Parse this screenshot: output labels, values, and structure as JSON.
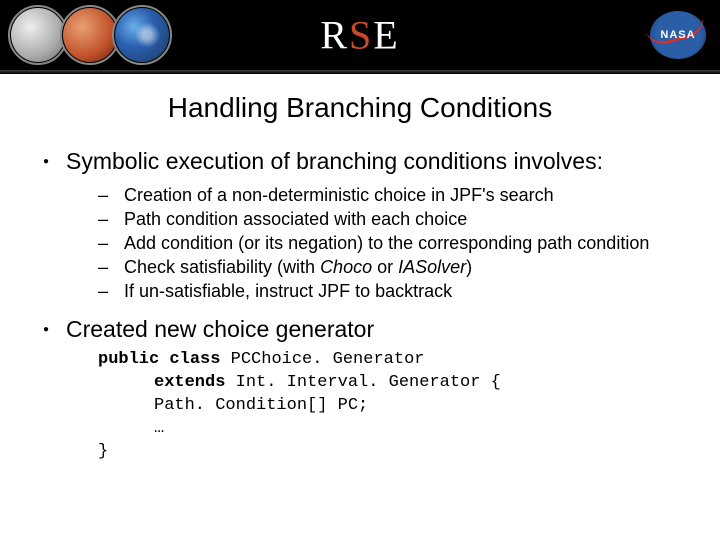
{
  "header": {
    "logo_R": "R",
    "logo_S": "S",
    "logo_E": "E",
    "nasa": "NASA"
  },
  "title": "Handling Branching Conditions",
  "bullets": {
    "b1": "Symbolic execution of branching conditions involves:",
    "sub": [
      "Creation of a non-deterministic choice in JPF's search",
      "Path condition associated with each choice",
      "Add condition (or its negation) to the corresponding path condition"
    ],
    "sub4_pre": "Check satisfiability (with ",
    "sub4_tool1": "Choco",
    "sub4_mid": " or ",
    "sub4_tool2": "IASolver",
    "sub4_post": ")",
    "sub5": "If un-satisfiable, instruct JPF to backtrack",
    "b2": "Created new choice generator"
  },
  "code": {
    "kw_public": "public",
    "kw_class": "class",
    "cls": " PCChoice. Generator",
    "kw_extends": "extends",
    "superc": " Int. Interval. Generator {",
    "field": "Path. Condition[] PC;",
    "dots": "…",
    "close": "}"
  }
}
